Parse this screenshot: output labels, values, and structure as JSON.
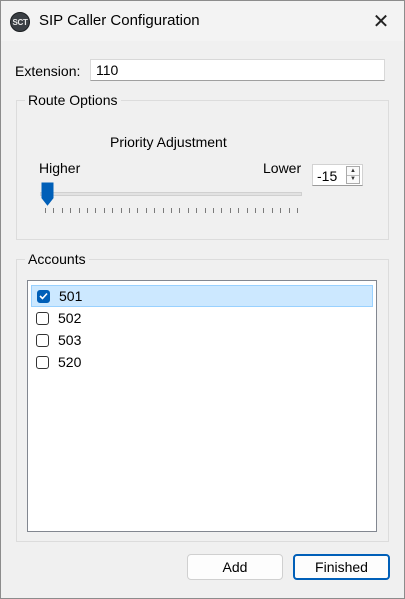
{
  "window": {
    "title": "SIP Caller Configuration",
    "icon_text": "SCT",
    "close_glyph": "✕"
  },
  "extension": {
    "label": "Extension:",
    "value": "110"
  },
  "route_options": {
    "group_label": "Route Options",
    "priority_title": "Priority Adjustment",
    "higher_label": "Higher",
    "lower_label": "Lower",
    "slider": {
      "min": -15,
      "max": 15,
      "value": -15,
      "tick_count": 31
    },
    "spin_value": "-15"
  },
  "accounts": {
    "group_label": "Accounts",
    "items": [
      {
        "label": "501",
        "checked": true,
        "selected": true
      },
      {
        "label": "502",
        "checked": false,
        "selected": false
      },
      {
        "label": "503",
        "checked": false,
        "selected": false
      },
      {
        "label": "520",
        "checked": false,
        "selected": false
      }
    ]
  },
  "buttons": {
    "add_label": "Add",
    "finished_label": "Finished"
  },
  "colors": {
    "accent": "#005fb8",
    "selection": "#cce8ff"
  }
}
